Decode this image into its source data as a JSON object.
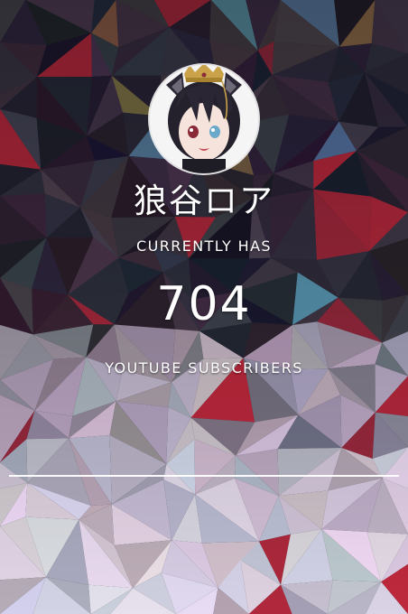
{
  "channel": {
    "name": "狼谷ロア",
    "avatar_icon": "vtuber-avatar-icon"
  },
  "stats": {
    "label_top": "CURRENTLY HAS",
    "count": "704",
    "label_bottom": "YOUTUBE SUBSCRIBERS",
    "subscriber_count": 704
  },
  "theme": {
    "text_color": "#ffffff",
    "background_dark": "#2a2530",
    "background_light": "#e6e2e0"
  }
}
